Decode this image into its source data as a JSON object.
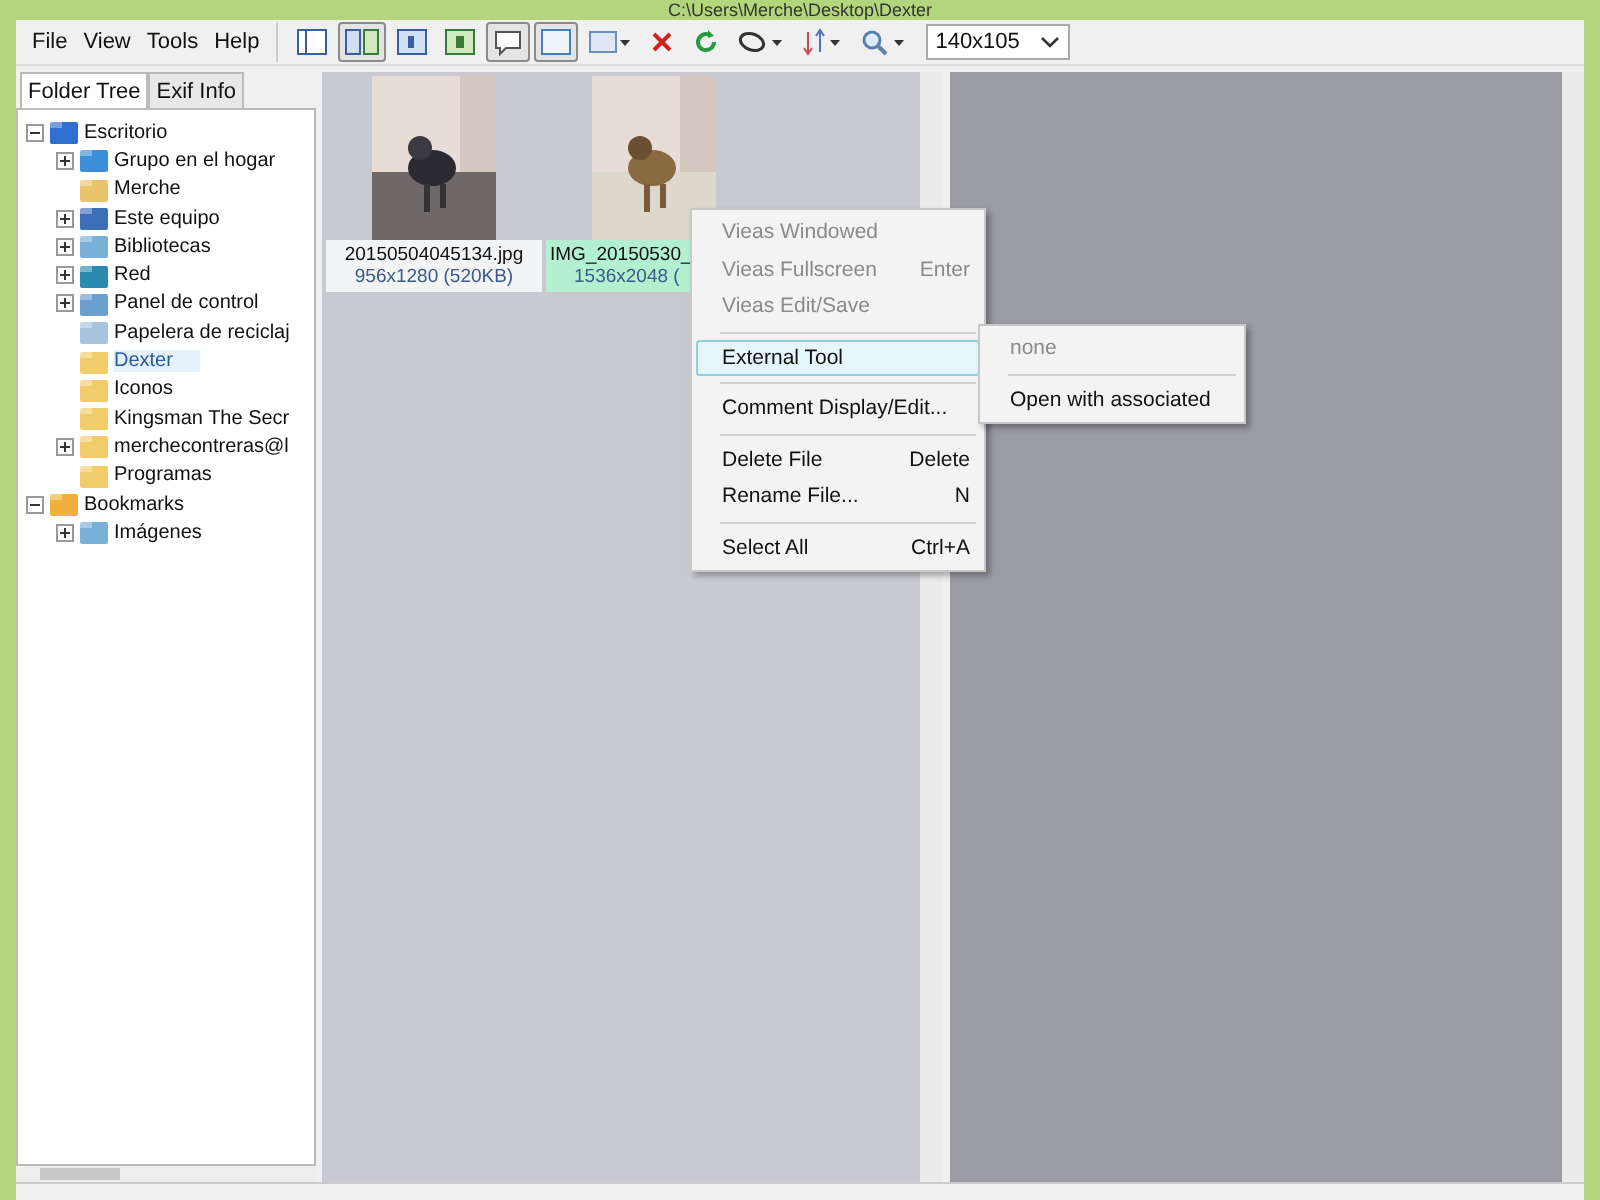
{
  "window": {
    "title": "C:\\Users\\Merche\\Desktop\\Dexter"
  },
  "menu": [
    "File",
    "View",
    "Tools",
    "Help"
  ],
  "toolbar": [
    {
      "kind": "panel",
      "pressed": false
    },
    {
      "kind": "split",
      "pressed": true
    },
    {
      "kind": "one",
      "pressed": false
    },
    {
      "kind": "two",
      "pressed": false
    },
    {
      "kind": "comment",
      "pressed": true
    },
    {
      "kind": "frame",
      "pressed": true
    },
    {
      "kind": "frame-drop",
      "pressed": false
    },
    {
      "kind": "delete",
      "pressed": false
    },
    {
      "kind": "refresh",
      "pressed": false
    },
    {
      "kind": "tag-drop",
      "pressed": false
    },
    {
      "kind": "sort-drop",
      "pressed": false
    },
    {
      "kind": "zoom-drop",
      "pressed": false
    }
  ],
  "size_select": {
    "value": "140x105"
  },
  "tabs": [
    {
      "label": "Folder Tree",
      "selected": true
    },
    {
      "label": "Exif Info",
      "selected": false
    }
  ],
  "tree": [
    {
      "label": "Escritorio",
      "kind": "desktop",
      "expanded": true,
      "selected": false,
      "children": [
        {
          "label": "Grupo en el hogar",
          "kind": "group",
          "expanded": false,
          "selected": false
        },
        {
          "label": "Merche",
          "kind": "user",
          "selected": false
        },
        {
          "label": "Este equipo",
          "kind": "computer",
          "expanded": false,
          "selected": false
        },
        {
          "label": "Bibliotecas",
          "kind": "library",
          "expanded": false,
          "selected": false
        },
        {
          "label": "Red",
          "kind": "network",
          "expanded": false,
          "selected": false
        },
        {
          "label": "Panel de control",
          "kind": "control",
          "expanded": false,
          "selected": false
        },
        {
          "label": "Papelera de reciclaj",
          "kind": "bin",
          "selected": false
        },
        {
          "label": "Dexter",
          "kind": "folder",
          "selected": true
        },
        {
          "label": "Iconos",
          "kind": "folder",
          "selected": false
        },
        {
          "label": "Kingsman The Secr",
          "kind": "folder",
          "selected": false
        },
        {
          "label": "merchecontreras@l",
          "kind": "folder",
          "expanded": false,
          "selected": false
        },
        {
          "label": "Programas",
          "kind": "folder",
          "selected": false
        }
      ]
    },
    {
      "label": "Bookmarks",
      "kind": "bookmark",
      "expanded": true,
      "selected": false,
      "children": [
        {
          "label": "Imágenes",
          "kind": "library",
          "expanded": false,
          "selected": false
        }
      ]
    }
  ],
  "thumbnails": [
    {
      "name": "20150504045134.jpg",
      "info": "956x1280 (520KB)",
      "selected": false,
      "kind": "picture"
    },
    {
      "name": "IMG_20150530_",
      "info": "1536x2048 (",
      "selected": true,
      "kind": "picture"
    }
  ],
  "context_menu": {
    "items": [
      {
        "kind": "item",
        "label": "Vieas Windowed",
        "disabled": true,
        "highlighted": false
      },
      {
        "kind": "item",
        "label": "Vieas Fullscreen",
        "shortcut": "Enter",
        "disabled": true,
        "highlighted": false
      },
      {
        "kind": "item",
        "label": "Vieas Edit/Save",
        "disabled": true,
        "highlighted": false
      },
      {
        "kind": "separator"
      },
      {
        "kind": "item",
        "label": "External Tool",
        "disabled": false,
        "highlighted": true
      },
      {
        "kind": "separator"
      },
      {
        "kind": "item",
        "label": "Comment Display/Edit...",
        "disabled": false,
        "highlighted": false
      },
      {
        "kind": "separator"
      },
      {
        "kind": "item",
        "label": "Delete File",
        "shortcut": "Delete",
        "disabled": false,
        "highlighted": false
      },
      {
        "kind": "item",
        "label": "Rename File...",
        "shortcut": "N",
        "disabled": false,
        "highlighted": false
      },
      {
        "kind": "separator"
      },
      {
        "kind": "item",
        "label": "Select All",
        "shortcut": "Ctrl+A",
        "disabled": false,
        "highlighted": false
      }
    ]
  },
  "submenu": {
    "items": [
      {
        "kind": "item",
        "label": "none",
        "disabled": true
      },
      {
        "kind": "separator"
      },
      {
        "kind": "item",
        "label": "Open with associated",
        "disabled": false
      }
    ]
  }
}
